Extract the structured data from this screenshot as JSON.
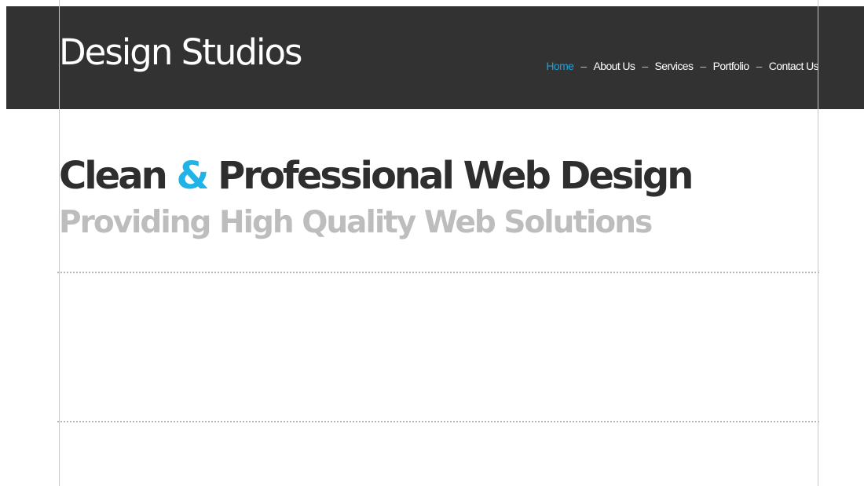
{
  "header": {
    "logo_text": "Design Studios",
    "background_color": "#323232"
  },
  "nav": {
    "items": [
      {
        "label": "Home",
        "active": true
      },
      {
        "label": "About Us",
        "active": false
      },
      {
        "label": "Services",
        "active": false
      },
      {
        "label": "Portfolio",
        "active": false
      },
      {
        "label": "Contact Us",
        "active": false
      }
    ],
    "separator": "–",
    "active_color": "#1fa1d4"
  },
  "hero": {
    "headline_part1": "Clean ",
    "headline_amp": "&",
    "headline_part2": " Professional Web Design",
    "subheadline": "Providing High Quality Web Solutions",
    "accent_color": "#1fb3e6"
  }
}
